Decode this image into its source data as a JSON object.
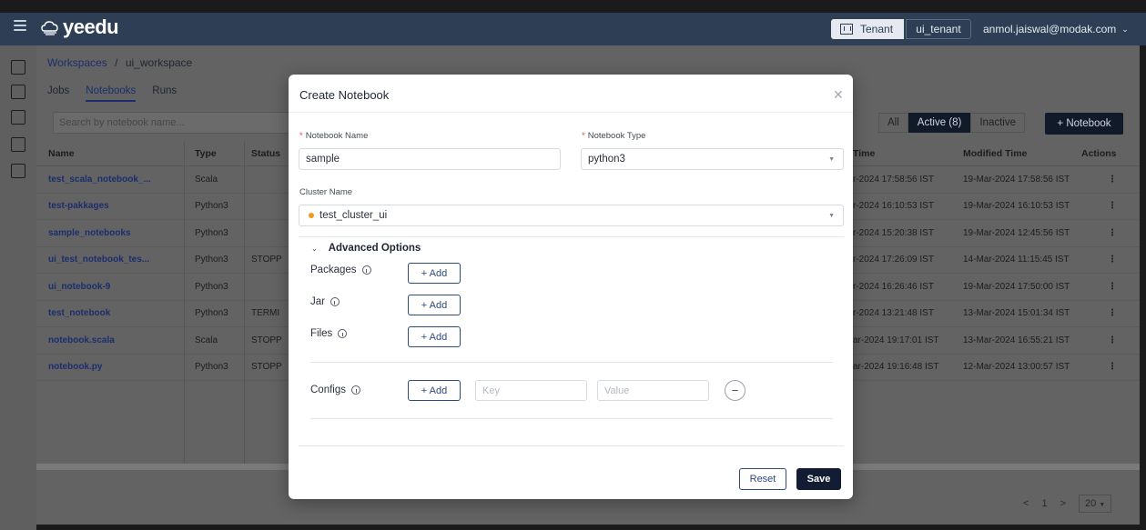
{
  "header": {
    "logo_text": "yeedu",
    "tenant_label": "Tenant",
    "tenant_value": "ui_tenant",
    "user_email": "anmol.jaiswal@modak.com"
  },
  "breadcrumb": {
    "root": "Workspaces",
    "sep": "/",
    "current": "ui_workspace"
  },
  "tabs": [
    "Jobs",
    "Notebooks",
    "Runs"
  ],
  "search": {
    "placeholder": "Search by notebook name..."
  },
  "filters": {
    "all": "All",
    "active": "Active (8)",
    "inactive": "Inactive"
  },
  "add_notebook_label": "+ Notebook",
  "table": {
    "headers": {
      "name": "Name",
      "type": "Type",
      "status": "Status",
      "created": "Time",
      "modified": "Modified Time",
      "actions": "Actions"
    },
    "rows": [
      {
        "name": "test_scala_notebook_...",
        "type": "Scala",
        "status": "",
        "created": "r-2024 17:58:56 IST",
        "modified": "19-Mar-2024 17:58:56 IST"
      },
      {
        "name": "test-pakkages",
        "type": "Python3",
        "status": "",
        "created": "r-2024 16:10:53 IST",
        "modified": "19-Mar-2024 16:10:53 IST"
      },
      {
        "name": "sample_notebooks",
        "type": "Python3",
        "status": "",
        "created": "r-2024 15:20:38 IST",
        "modified": "19-Mar-2024 12:45:56 IST"
      },
      {
        "name": "ui_test_notebook_tes...",
        "type": "Python3",
        "status": "STOPP",
        "created": "r-2024 17:26:09 IST",
        "modified": "14-Mar-2024 11:15:45 IST"
      },
      {
        "name": "ui_notebook-9",
        "type": "Python3",
        "status": "",
        "created": "r-2024 16:26:46 IST",
        "modified": "19-Mar-2024 17:50:00 IST"
      },
      {
        "name": "test_notebook",
        "type": "Python3",
        "status": "TERMI",
        "created": "r-2024 13:21:48 IST",
        "modified": "13-Mar-2024 15:01:34 IST"
      },
      {
        "name": "notebook.scala",
        "type": "Scala",
        "status": "STOPP",
        "created": "ar-2024 19:17:01 IST",
        "modified": "13-Mar-2024 16:55:21 IST"
      },
      {
        "name": "notebook.py",
        "type": "Python3",
        "status": "STOPP",
        "created": "ar-2024 19:16:48 IST",
        "modified": "12-Mar-2024 13:00:57 IST"
      }
    ]
  },
  "pager": {
    "prev": "<",
    "page": "1",
    "next": ">",
    "size": "20"
  },
  "modal": {
    "title": "Create Notebook",
    "notebook_name_label": "Notebook Name",
    "notebook_name_value": "sample",
    "notebook_type_label": "Notebook Type",
    "notebook_type_value": "python3",
    "cluster_name_label": "Cluster Name",
    "cluster_name_value": "test_cluster_ui",
    "advanced_label": "Advanced Options",
    "packages_label": "Packages",
    "jar_label": "Jar",
    "files_label": "Files",
    "configs_label": "Configs",
    "add_label": "+ Add",
    "key_placeholder": "Key",
    "value_placeholder": "Value",
    "reset_label": "Reset",
    "save_label": "Save",
    "required_mark": "*"
  },
  "colors": {
    "header_bg": "#2d3e55",
    "primary": "#121d33",
    "cluster_status": "#f29a20",
    "required": "#e5484d"
  }
}
